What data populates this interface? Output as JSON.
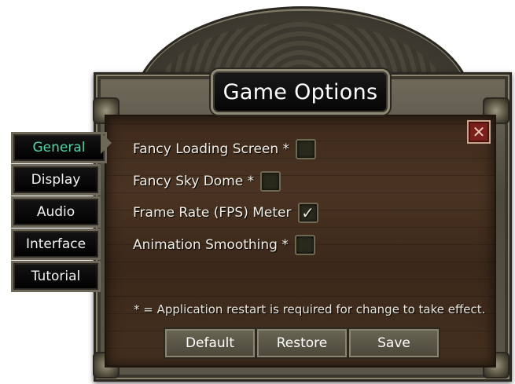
{
  "window": {
    "title": "Game Options"
  },
  "tabs": [
    {
      "label": "General",
      "active": true
    },
    {
      "label": "Display",
      "active": false
    },
    {
      "label": "Audio",
      "active": false
    },
    {
      "label": "Interface",
      "active": false
    },
    {
      "label": "Tutorial",
      "active": false
    }
  ],
  "options": [
    {
      "label": "Fancy Loading Screen *",
      "checked": false
    },
    {
      "label": "Fancy Sky Dome *",
      "checked": false
    },
    {
      "label": "Frame Rate (FPS) Meter",
      "checked": true
    },
    {
      "label": "Animation Smoothing *",
      "checked": false
    }
  ],
  "footnote": "* = Application restart is required for change to take effect.",
  "buttons": {
    "default": "Default",
    "restore": "Restore",
    "save": "Save"
  },
  "icons": {
    "close": "close-icon",
    "check": "checkmark-icon"
  },
  "colors": {
    "active_tab": "#4fd6a8",
    "close_bg": "#7a1f1a"
  }
}
